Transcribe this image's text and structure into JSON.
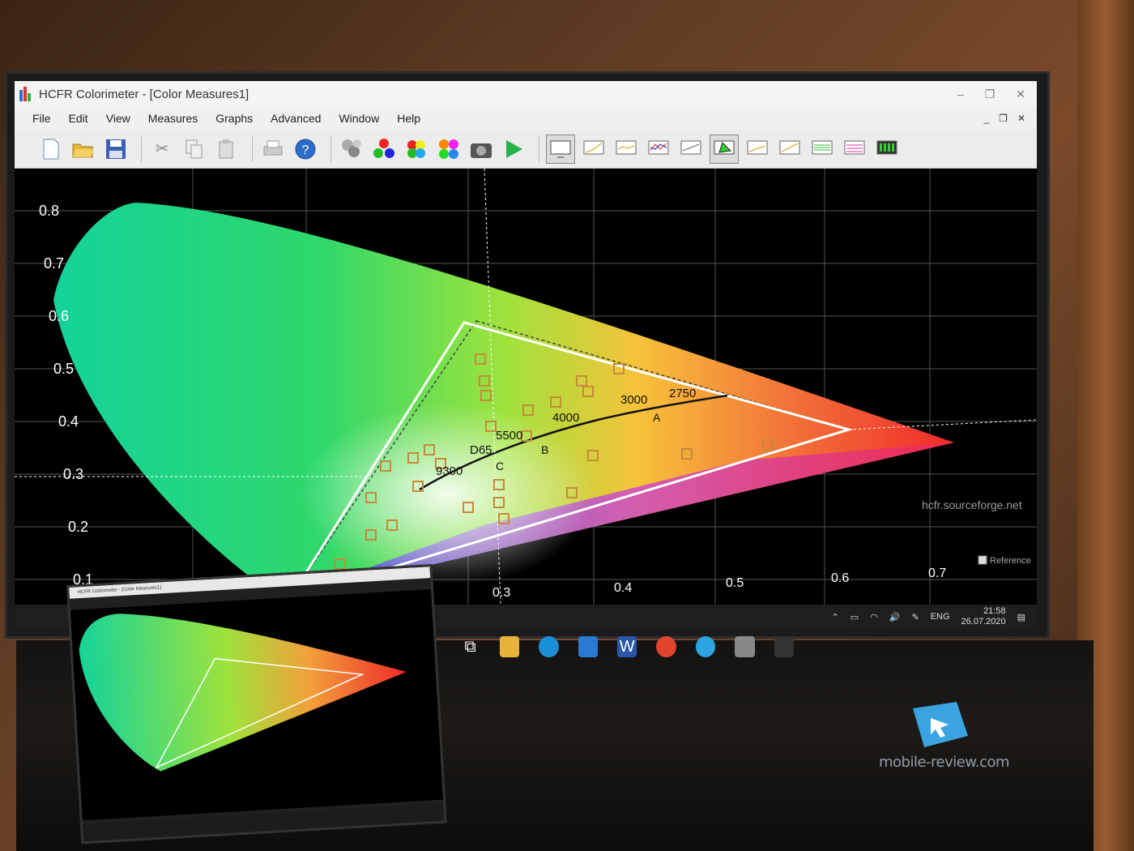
{
  "window": {
    "title": "HCFR Colorimeter - [Color Measures1]",
    "controls": [
      "–",
      "❐",
      "✕"
    ]
  },
  "menu": {
    "items": [
      "File",
      "Edit",
      "View",
      "Measures",
      "Graphs",
      "Advanced",
      "Window",
      "Help"
    ],
    "doc_controls": [
      "_",
      "❐",
      "✕"
    ]
  },
  "toolbar": {
    "icons": [
      "new-icon",
      "open-icon",
      "save-icon",
      "cut-icon",
      "copy-icon",
      "paste-icon",
      "print-icon",
      "help-icon",
      "sensor-icon",
      "rgb-icon",
      "colors-icon",
      "saturations-icon",
      "camera-icon",
      "play-icon",
      "measures-view-icon",
      "gamma-icon",
      "luminance-icon",
      "rgb-levels-icon",
      "color-temp-icon",
      "cie-diagram-icon",
      "near-black-icon",
      "near-white-icon",
      "saturation-shift-icon",
      "saturation-lum-icon",
      "color-comparator-icon"
    ]
  },
  "plot": {
    "y_ticks": [
      "0.8",
      "0.7",
      "0.6",
      "0.5",
      "0.4",
      "0.3",
      "0.2",
      "0.1"
    ],
    "x_ticks": [
      "0.3",
      "0.4",
      "0.5",
      "0.6",
      "0.7"
    ],
    "temps": [
      "9300",
      "D65",
      "5500",
      "4000",
      "3000",
      "2750"
    ],
    "illuminants": [
      "B",
      "A",
      "C"
    ],
    "credit": "hcfr.sourceforge.net",
    "reference_label": "Reference"
  },
  "taskbar": {
    "lang": "ENG",
    "time": "21:58",
    "date": "26.07.2020"
  },
  "watermark": "mobile-review.com"
}
